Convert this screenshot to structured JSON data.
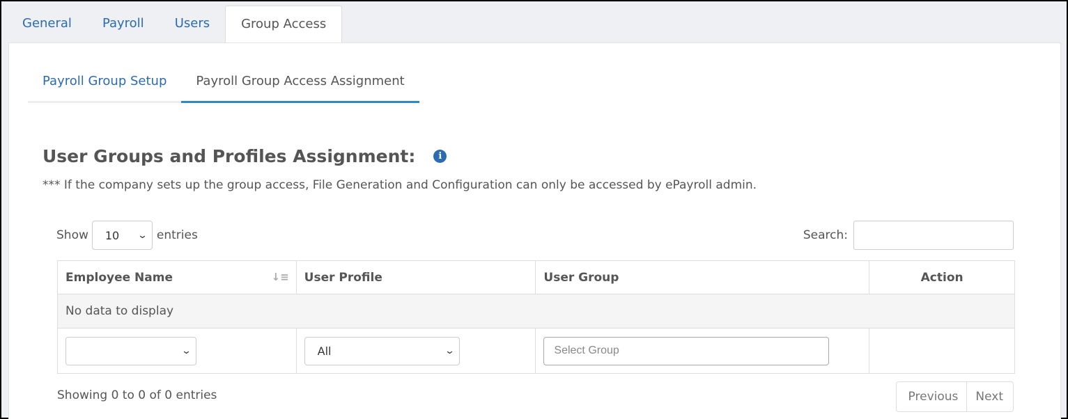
{
  "top_tabs": [
    {
      "label": "General"
    },
    {
      "label": "Payroll"
    },
    {
      "label": "Users"
    },
    {
      "label": "Group Access"
    }
  ],
  "active_top_tab": "Group Access",
  "sub_tabs": [
    {
      "label": "Payroll Group Setup"
    },
    {
      "label": "Payroll Group Access Assignment"
    }
  ],
  "active_sub_tab": "Payroll Group Access Assignment",
  "section": {
    "title": "User Groups and Profiles Assignment:",
    "info_icon": "info-icon",
    "note": "*** If the company sets up the group access, File Generation and Configuration can only be accessed by ePayroll admin."
  },
  "length_control": {
    "show_label": "Show",
    "value": "10",
    "entries_label": "entries"
  },
  "search": {
    "label": "Search:",
    "value": ""
  },
  "table": {
    "columns": [
      "Employee Name",
      "User Profile",
      "User Group",
      "Action"
    ],
    "sort_icon": "sort-alpha-down-icon",
    "empty_message": "No data to display",
    "filters": {
      "employee_name": "",
      "user_profile": "All",
      "user_group_placeholder": "Select Group"
    }
  },
  "footer": {
    "info": "Showing 0 to 0 of 0 entries",
    "previous": "Previous",
    "next": "Next"
  },
  "colors": {
    "link_blue": "#2b6cb0",
    "active_underline": "#2b8ac6",
    "text_gray": "#555555"
  }
}
